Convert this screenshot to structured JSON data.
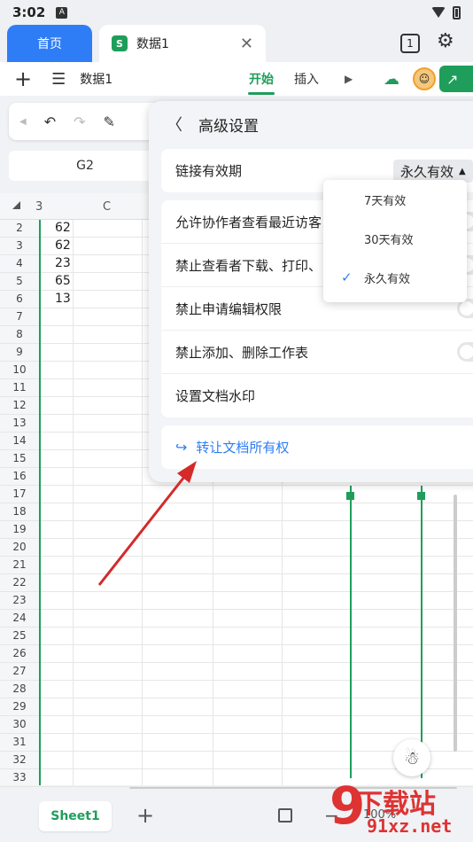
{
  "status": {
    "time": "3:02",
    "notif": "A"
  },
  "tabs": {
    "home": "首页",
    "doc": "数据1",
    "count": "1"
  },
  "toolbar": {
    "doc_name": "数据1",
    "tab_start": "开始",
    "tab_insert": "插入"
  },
  "cell_ref": "G2",
  "columns": {
    "b": "3",
    "c": "C"
  },
  "rows": [
    {
      "num": "2",
      "val": "62"
    },
    {
      "num": "3",
      "val": "62"
    },
    {
      "num": "4",
      "val": "23"
    },
    {
      "num": "5",
      "val": "65"
    },
    {
      "num": "6",
      "val": "13"
    },
    {
      "num": "7",
      "val": ""
    },
    {
      "num": "8",
      "val": ""
    },
    {
      "num": "9",
      "val": ""
    },
    {
      "num": "10",
      "val": ""
    },
    {
      "num": "11",
      "val": ""
    },
    {
      "num": "12",
      "val": ""
    },
    {
      "num": "13",
      "val": ""
    },
    {
      "num": "14",
      "val": ""
    },
    {
      "num": "15",
      "val": ""
    },
    {
      "num": "16",
      "val": ""
    },
    {
      "num": "17",
      "val": ""
    },
    {
      "num": "18",
      "val": ""
    },
    {
      "num": "19",
      "val": ""
    },
    {
      "num": "20",
      "val": ""
    },
    {
      "num": "21",
      "val": ""
    },
    {
      "num": "22",
      "val": ""
    },
    {
      "num": "23",
      "val": ""
    },
    {
      "num": "24",
      "val": ""
    },
    {
      "num": "25",
      "val": ""
    },
    {
      "num": "26",
      "val": ""
    },
    {
      "num": "27",
      "val": ""
    },
    {
      "num": "28",
      "val": ""
    },
    {
      "num": "29",
      "val": ""
    },
    {
      "num": "30",
      "val": ""
    },
    {
      "num": "31",
      "val": ""
    },
    {
      "num": "32",
      "val": ""
    },
    {
      "num": "33",
      "val": ""
    }
  ],
  "panel": {
    "title": "高级设置",
    "link_expiry_label": "链接有效期",
    "link_expiry_value": "永久有效",
    "settings": [
      "允许协作者查看最近访客",
      "禁止查看者下载、打印、",
      "禁止申请编辑权限",
      "禁止添加、删除工作表",
      "设置文档水印"
    ],
    "transfer": "转让文档所有权"
  },
  "dropdown": {
    "options": [
      "7天有效",
      "30天有效",
      "永久有效"
    ],
    "selected": "永久有效"
  },
  "bottom": {
    "sheet": "Sheet1",
    "zoom": "100%"
  },
  "watermark": {
    "big": "9",
    "top": "下载站",
    "bottom": "91xz.net"
  },
  "colors": {
    "brand_green": "#1e9e5a",
    "accent_blue": "#2f7df6",
    "arrow_red": "#d42a2a"
  }
}
